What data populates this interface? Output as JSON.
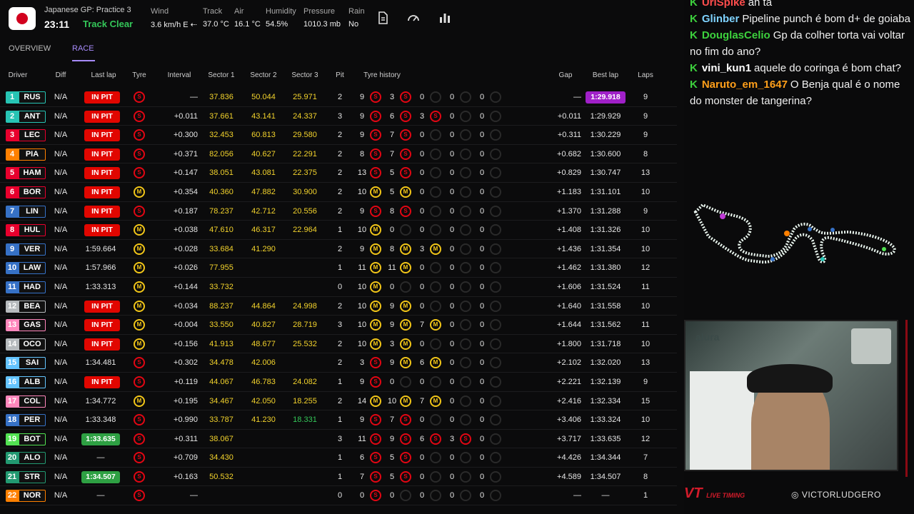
{
  "session": {
    "title": "Japanese GP: Practice 3",
    "clock": "23:11",
    "status": "Track Clear"
  },
  "weather": [
    {
      "label": "Wind",
      "value": "3.6 km/h E ⇠"
    },
    {
      "label": "Track",
      "value": "37.0 °C"
    },
    {
      "label": "Air",
      "value": "16.1 °C"
    },
    {
      "label": "Humidity",
      "value": "54.5%"
    },
    {
      "label": "Pressure",
      "value": "1010.3 mb"
    },
    {
      "label": "Rain",
      "value": "No"
    }
  ],
  "toolbar_icons": [
    "document-icon",
    "speedometer-icon",
    "bar-chart-icon"
  ],
  "tabs": [
    "OVERVIEW",
    "RACE"
  ],
  "columns": [
    "Driver",
    "Diff",
    "Last lap",
    "Tyre",
    "Interval",
    "Sector 1",
    "Sector 2",
    "Sector 3",
    "Pit",
    "Tyre history",
    "Gap",
    "Best lap",
    "Laps"
  ],
  "drivers": [
    {
      "pos": "1",
      "code": "RUS",
      "color": "#27c4b4",
      "diff": "N/A",
      "last": "IN PIT",
      "tyre": "S",
      "interval": "—",
      "s1": "37.836",
      "s2": "50.044",
      "s3": "25.971",
      "pit": "2",
      "hist": [
        [
          "9",
          "S"
        ],
        [
          "3",
          "S"
        ],
        [
          "0",
          ""
        ],
        [
          "0",
          ""
        ],
        [
          "0",
          ""
        ]
      ],
      "gap": "—",
      "best": "1:29.918",
      "bestp": true,
      "laps": "9"
    },
    {
      "pos": "2",
      "code": "ANT",
      "color": "#27c4b4",
      "diff": "N/A",
      "last": "IN PIT",
      "tyre": "S",
      "interval": "+0.011",
      "s1": "37.661",
      "s2": "43.141",
      "s3": "24.337",
      "pit": "3",
      "hist": [
        [
          "9",
          "S"
        ],
        [
          "6",
          "S"
        ],
        [
          "3",
          "S"
        ],
        [
          "0",
          ""
        ],
        [
          "0",
          ""
        ]
      ],
      "gap": "+0.011",
      "best": "1:29.929",
      "laps": "9"
    },
    {
      "pos": "3",
      "code": "LEC",
      "color": "#e8002d",
      "diff": "N/A",
      "last": "IN PIT",
      "tyre": "S",
      "interval": "+0.300",
      "s1": "32.453",
      "s2": "60.813",
      "s3": "29.580",
      "pit": "2",
      "hist": [
        [
          "9",
          "S"
        ],
        [
          "7",
          "S"
        ],
        [
          "0",
          ""
        ],
        [
          "0",
          ""
        ],
        [
          "0",
          ""
        ]
      ],
      "gap": "+0.311",
      "best": "1:30.229",
      "laps": "9"
    },
    {
      "pos": "4",
      "code": "PIA",
      "color": "#ff8000",
      "diff": "N/A",
      "last": "IN PIT",
      "tyre": "S",
      "interval": "+0.371",
      "s1": "82.056",
      "s2": "40.627",
      "s3": "22.291",
      "pit": "2",
      "hist": [
        [
          "8",
          "S"
        ],
        [
          "7",
          "S"
        ],
        [
          "0",
          ""
        ],
        [
          "0",
          ""
        ],
        [
          "0",
          ""
        ]
      ],
      "gap": "+0.682",
      "best": "1:30.600",
      "laps": "8"
    },
    {
      "pos": "5",
      "code": "HAM",
      "color": "#e8002d",
      "diff": "N/A",
      "last": "IN PIT",
      "tyre": "S",
      "interval": "+0.147",
      "s1": "38.051",
      "s2": "43.081",
      "s3": "22.375",
      "pit": "2",
      "hist": [
        [
          "13",
          "S"
        ],
        [
          "5",
          "S"
        ],
        [
          "0",
          ""
        ],
        [
          "0",
          ""
        ],
        [
          "0",
          ""
        ]
      ],
      "gap": "+0.829",
      "best": "1:30.747",
      "laps": "13"
    },
    {
      "pos": "6",
      "code": "BOR",
      "color": "#e8002d",
      "diff": "N/A",
      "last": "IN PIT",
      "tyre": "M",
      "interval": "+0.354",
      "s1": "40.360",
      "s2": "47.882",
      "s3": "30.900",
      "pit": "2",
      "hist": [
        [
          "10",
          "M"
        ],
        [
          "5",
          "M"
        ],
        [
          "0",
          ""
        ],
        [
          "0",
          ""
        ],
        [
          "0",
          ""
        ]
      ],
      "gap": "+1.183",
      "best": "1:31.101",
      "laps": "10"
    },
    {
      "pos": "7",
      "code": "LIN",
      "color": "#3671c6",
      "diff": "N/A",
      "last": "IN PIT",
      "tyre": "S",
      "interval": "+0.187",
      "s1": "78.237",
      "s2": "42.712",
      "s3": "20.556",
      "pit": "2",
      "hist": [
        [
          "9",
          "S"
        ],
        [
          "8",
          "S"
        ],
        [
          "0",
          ""
        ],
        [
          "0",
          ""
        ],
        [
          "0",
          ""
        ]
      ],
      "gap": "+1.370",
      "best": "1:31.288",
      "laps": "9"
    },
    {
      "pos": "8",
      "code": "HUL",
      "color": "#e8002d",
      "diff": "N/A",
      "last": "IN PIT",
      "tyre": "M",
      "interval": "+0.038",
      "s1": "47.610",
      "s2": "46.317",
      "s3": "22.964",
      "pit": "1",
      "hist": [
        [
          "10",
          "M"
        ],
        [
          "0",
          ""
        ],
        [
          "0",
          ""
        ],
        [
          "0",
          ""
        ],
        [
          "0",
          ""
        ]
      ],
      "gap": "+1.408",
      "best": "1:31.326",
      "laps": "10"
    },
    {
      "pos": "9",
      "code": "VER",
      "color": "#3671c6",
      "diff": "N/A",
      "last": "1:59.664",
      "tyre": "M",
      "interval": "+0.028",
      "s1": "33.684",
      "s2": "41.290",
      "s3": "",
      "pit": "2",
      "hist": [
        [
          "9",
          "M"
        ],
        [
          "8",
          "M"
        ],
        [
          "3",
          "M"
        ],
        [
          "0",
          ""
        ],
        [
          "0",
          ""
        ]
      ],
      "gap": "+1.436",
      "best": "1:31.354",
      "laps": "10"
    },
    {
      "pos": "10",
      "code": "LAW",
      "color": "#3671c6",
      "diff": "N/A",
      "last": "1:57.966",
      "tyre": "M",
      "interval": "+0.026",
      "s1": "77.955",
      "s2": "",
      "s3": "",
      "pit": "1",
      "hist": [
        [
          "11",
          "M"
        ],
        [
          "11",
          "M"
        ],
        [
          "0",
          ""
        ],
        [
          "0",
          ""
        ],
        [
          "0",
          ""
        ]
      ],
      "gap": "+1.462",
      "best": "1:31.380",
      "laps": "12"
    },
    {
      "pos": "11",
      "code": "HAD",
      "color": "#3671c6",
      "diff": "N/A",
      "last": "1:33.313",
      "tyre": "M",
      "interval": "+0.144",
      "s1": "33.732",
      "s2": "",
      "s3": "",
      "pit": "0",
      "hist": [
        [
          "10",
          "M"
        ],
        [
          "0",
          ""
        ],
        [
          "0",
          ""
        ],
        [
          "0",
          ""
        ],
        [
          "0",
          ""
        ]
      ],
      "gap": "+1.606",
      "best": "1:31.524",
      "laps": "11"
    },
    {
      "pos": "12",
      "code": "BEA",
      "color": "#b6babd",
      "diff": "N/A",
      "last": "IN PIT",
      "tyre": "M",
      "interval": "+0.034",
      "s1": "88.237",
      "s2": "44.864",
      "s3": "24.998",
      "pit": "2",
      "hist": [
        [
          "10",
          "M"
        ],
        [
          "9",
          "M"
        ],
        [
          "0",
          ""
        ],
        [
          "0",
          ""
        ],
        [
          "0",
          ""
        ]
      ],
      "gap": "+1.640",
      "best": "1:31.558",
      "laps": "10"
    },
    {
      "pos": "13",
      "code": "GAS",
      "color": "#ff87bc",
      "diff": "N/A",
      "last": "IN PIT",
      "tyre": "M",
      "interval": "+0.004",
      "s1": "33.550",
      "s2": "40.827",
      "s3": "28.719",
      "pit": "3",
      "hist": [
        [
          "10",
          "M"
        ],
        [
          "9",
          "M"
        ],
        [
          "7",
          "M"
        ],
        [
          "0",
          ""
        ],
        [
          "0",
          ""
        ]
      ],
      "gap": "+1.644",
      "best": "1:31.562",
      "laps": "11"
    },
    {
      "pos": "14",
      "code": "OCO",
      "color": "#b6babd",
      "diff": "N/A",
      "last": "IN PIT",
      "tyre": "M",
      "interval": "+0.156",
      "s1": "41.913",
      "s2": "48.677",
      "s3": "25.532",
      "pit": "2",
      "hist": [
        [
          "10",
          "M"
        ],
        [
          "3",
          "M"
        ],
        [
          "0",
          ""
        ],
        [
          "0",
          ""
        ],
        [
          "0",
          ""
        ]
      ],
      "gap": "+1.800",
      "best": "1:31.718",
      "laps": "10"
    },
    {
      "pos": "15",
      "code": "SAI",
      "color": "#64c4ff",
      "diff": "N/A",
      "last": "1:34.481",
      "tyre": "S",
      "interval": "+0.302",
      "s1": "34.478",
      "s2": "42.006",
      "s3": "",
      "pit": "2",
      "hist": [
        [
          "3",
          "S"
        ],
        [
          "9",
          "M"
        ],
        [
          "6",
          "M"
        ],
        [
          "0",
          ""
        ],
        [
          "0",
          ""
        ]
      ],
      "gap": "+2.102",
      "best": "1:32.020",
      "laps": "13"
    },
    {
      "pos": "16",
      "code": "ALB",
      "color": "#64c4ff",
      "diff": "N/A",
      "last": "IN PIT",
      "tyre": "S",
      "interval": "+0.119",
      "s1": "44.067",
      "s2": "46.783",
      "s3": "24.082",
      "pit": "1",
      "hist": [
        [
          "9",
          "S"
        ],
        [
          "0",
          ""
        ],
        [
          "0",
          ""
        ],
        [
          "0",
          ""
        ],
        [
          "0",
          ""
        ]
      ],
      "gap": "+2.221",
      "best": "1:32.139",
      "laps": "9"
    },
    {
      "pos": "17",
      "code": "COL",
      "color": "#ff87bc",
      "diff": "N/A",
      "last": "1:34.772",
      "tyre": "M",
      "interval": "+0.195",
      "s1": "34.467",
      "s2": "42.050",
      "s3": "18.255",
      "pit": "2",
      "hist": [
        [
          "14",
          "M"
        ],
        [
          "10",
          "M"
        ],
        [
          "7",
          "M"
        ],
        [
          "0",
          ""
        ],
        [
          "0",
          ""
        ]
      ],
      "gap": "+2.416",
      "best": "1:32.334",
      "laps": "15"
    },
    {
      "pos": "18",
      "code": "PER",
      "color": "#3671c6",
      "diff": "N/A",
      "last": "1:33.348",
      "tyre": "S",
      "interval": "+0.990",
      "s1": "33.787",
      "s2": "41.230",
      "s3": "18.331",
      "s3g": true,
      "pit": "1",
      "hist": [
        [
          "9",
          "S"
        ],
        [
          "7",
          "S"
        ],
        [
          "0",
          ""
        ],
        [
          "0",
          ""
        ],
        [
          "0",
          ""
        ]
      ],
      "gap": "+3.406",
      "best": "1:33.324",
      "laps": "10"
    },
    {
      "pos": "19",
      "code": "BOT",
      "color": "#52e252",
      "diff": "N/A",
      "last": "1:33.635",
      "lastg": true,
      "tyre": "S",
      "interval": "+0.311",
      "s1": "38.067",
      "s2": "",
      "s3": "",
      "pit": "3",
      "hist": [
        [
          "11",
          "S"
        ],
        [
          "9",
          "S"
        ],
        [
          "6",
          "S"
        ],
        [
          "3",
          "S"
        ],
        [
          "0",
          ""
        ]
      ],
      "gap": "+3.717",
      "best": "1:33.635",
      "laps": "12"
    },
    {
      "pos": "20",
      "code": "ALO",
      "color": "#229971",
      "diff": "N/A",
      "last": "—",
      "tyre": "S",
      "interval": "+0.709",
      "s1": "34.430",
      "s2": "",
      "s3": "",
      "pit": "1",
      "hist": [
        [
          "6",
          "S"
        ],
        [
          "5",
          "S"
        ],
        [
          "0",
          ""
        ],
        [
          "0",
          ""
        ],
        [
          "0",
          ""
        ]
      ],
      "gap": "+4.426",
      "best": "1:34.344",
      "laps": "7"
    },
    {
      "pos": "21",
      "code": "STR",
      "color": "#229971",
      "diff": "N/A",
      "last": "1:34.507",
      "lastg": true,
      "tyre": "S",
      "interval": "+0.163",
      "s1": "50.532",
      "s2": "",
      "s3": "",
      "pit": "1",
      "hist": [
        [
          "7",
          "S"
        ],
        [
          "5",
          "S"
        ],
        [
          "0",
          ""
        ],
        [
          "0",
          ""
        ],
        [
          "0",
          ""
        ]
      ],
      "gap": "+4.589",
      "best": "1:34.507",
      "laps": "8"
    },
    {
      "pos": "22",
      "code": "NOR",
      "color": "#ff8000",
      "diff": "N/A",
      "last": "—",
      "tyre": "S",
      "interval": "—",
      "s1": "",
      "s2": "",
      "s3": "",
      "pit": "0",
      "hist": [
        [
          "0",
          "S"
        ],
        [
          "0",
          ""
        ],
        [
          "0",
          ""
        ],
        [
          "0",
          ""
        ],
        [
          "0",
          ""
        ]
      ],
      "gap": "—",
      "best": "—",
      "laps": "1"
    }
  ],
  "chat": [
    {
      "user": "UriSpike",
      "color": "#ff4d4d",
      "text": "ah ta"
    },
    {
      "user": "Glinber",
      "color": "#7fd3ff",
      "text": "Pipeline punch é bom d+ de goiaba"
    },
    {
      "user": "DouglasCelio",
      "color": "#3dd13d",
      "text": "Gp da colher torta vai voltar no fim do ano?"
    },
    {
      "user": "vini_kun1",
      "color": "#ffffff",
      "text": "aquele do coringa é bom chat?"
    },
    {
      "user": "Naruto_em_1647",
      "color": "#ff9f1a",
      "text": "O Benja qual é o nome do monster de tangerina?"
    }
  ],
  "overlay": {
    "brand": "LIVE TIMING",
    "handle": "VICTORLUDGERO",
    "cam_logo": "alura"
  }
}
